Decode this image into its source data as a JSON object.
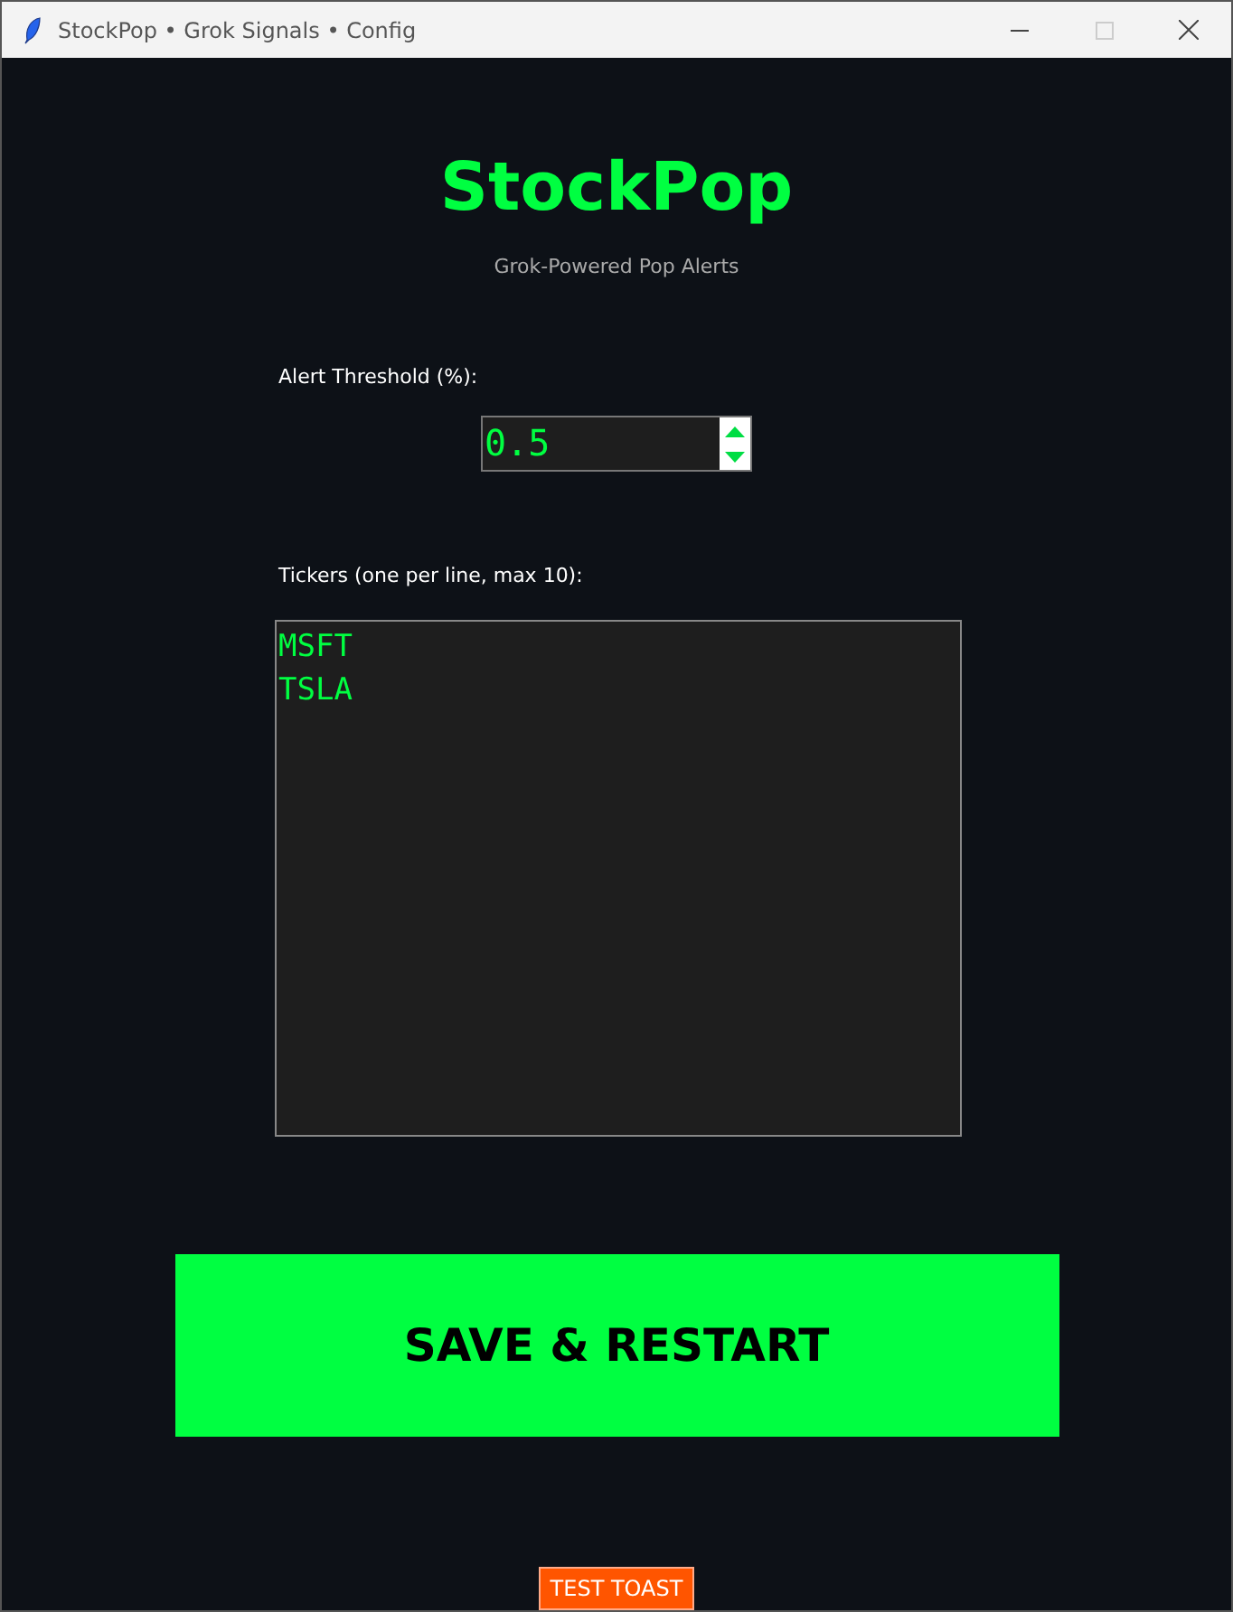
{
  "window": {
    "title": "StockPop • Grok Signals • Config"
  },
  "header": {
    "title": "StockPop",
    "subtitle": "Grok-Powered Pop Alerts"
  },
  "threshold": {
    "label": "Alert Threshold (%):",
    "value": "0.5"
  },
  "tickers": {
    "label": "Tickers (one per line, max 10):",
    "value": "MSFT\nTSLA"
  },
  "buttons": [
    {
      "kind": "primary",
      "label": "SAVE & RESTART"
    },
    {
      "kind": "test",
      "label": "TEST TOAST"
    }
  ]
}
